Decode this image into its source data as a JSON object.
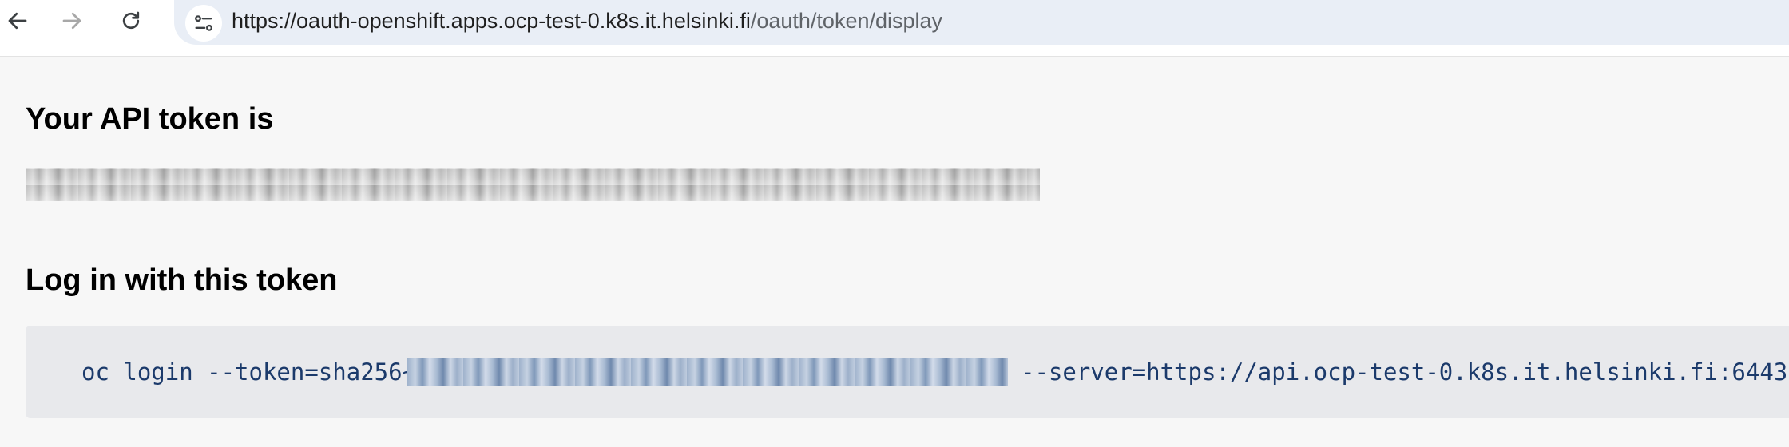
{
  "browser": {
    "url_host": "https://oauth-openshift.apps.ocp-test-0.k8s.it.helsinki.fi",
    "url_path": "/oauth/token/display",
    "icons": [
      "arrow-left-icon",
      "arrow-right-icon",
      "reload-icon",
      "site-settings-icon"
    ]
  },
  "page": {
    "token_heading": "Your API token is",
    "login_heading": "Log in with this token",
    "command_prefix": "oc login --token=sha256~",
    "command_suffix": "--server=https://api.ocp-test-0.k8s.it.helsinki.fi:6443"
  }
}
